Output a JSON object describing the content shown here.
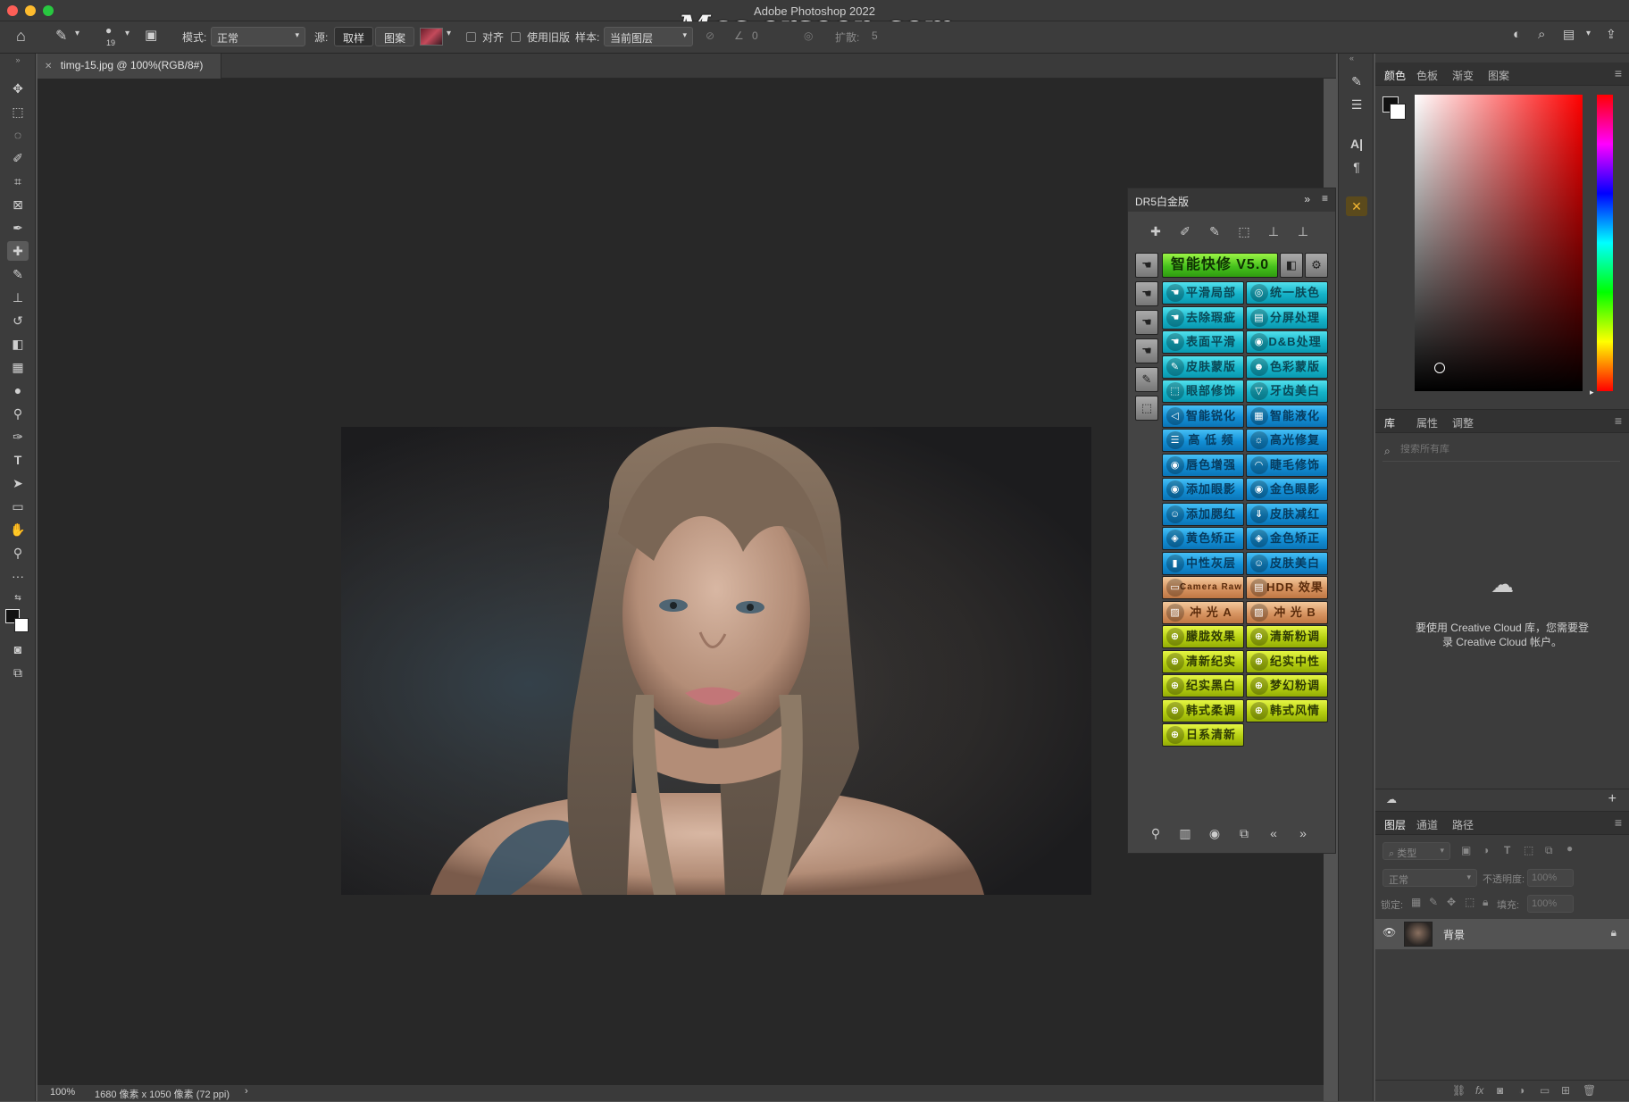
{
  "app": {
    "title": "Adobe Photoshop 2022",
    "watermark": "Mac.orsoon.com"
  },
  "options_bar": {
    "brush_size": "19",
    "mode_label": "模式:",
    "mode_value": "正常",
    "source_label": "源:",
    "sample_btn": "取样",
    "pattern_btn": "图案",
    "align_label": "对齐",
    "legacy_label": "使用旧版",
    "sample_label": "样本:",
    "sample_value": "当前图层",
    "angle_value": "0",
    "diffuse_label": "扩散:",
    "diffuse_value": "5"
  },
  "document": {
    "tab_label": "timg-15.jpg @ 100%(RGB/8#)",
    "zoom": "100%",
    "info": "1680 像素 x 1050 像素 (72 ppi)"
  },
  "drs_panel": {
    "title": "DR5白金版",
    "header_button": "智能快修 V5.0",
    "buttons": [
      {
        "label": "平滑局部",
        "icon": "hand-icon",
        "color": "teal"
      },
      {
        "label": "统一肤色",
        "icon": "swirl-icon",
        "color": "teal"
      },
      {
        "label": "去除瑕疵",
        "icon": "hand-icon",
        "color": "teal"
      },
      {
        "label": "分屏处理",
        "icon": "doc-icon",
        "color": "teal"
      },
      {
        "label": "表面平滑",
        "icon": "hand-icon",
        "color": "teal"
      },
      {
        "label": "D&B处理",
        "icon": "camera-icon",
        "color": "teal"
      },
      {
        "label": "皮肤蒙版",
        "icon": "brush-icon",
        "color": "teal"
      },
      {
        "label": "色彩蒙版",
        "icon": "people-icon",
        "color": "teal"
      },
      {
        "label": "眼部修饰",
        "icon": "select-icon",
        "color": "teal"
      },
      {
        "label": "牙齿美白",
        "icon": "tooth-icon",
        "color": "teal"
      },
      {
        "label": "智能锐化",
        "icon": "triangle-icon",
        "color": "blue"
      },
      {
        "label": "智能液化",
        "icon": "grid-icon",
        "color": "blue"
      },
      {
        "label": "高 低 频",
        "icon": "list-icon",
        "color": "blue"
      },
      {
        "label": "高光修复",
        "icon": "sun-icon",
        "color": "blue"
      },
      {
        "label": "唇色增强",
        "icon": "lips-icon",
        "color": "blue"
      },
      {
        "label": "睫毛修饰",
        "icon": "lash-icon",
        "color": "blue"
      },
      {
        "label": "添加眼影",
        "icon": "eye-icon",
        "color": "blue"
      },
      {
        "label": "金色眼影",
        "icon": "eye-icon",
        "color": "blue"
      },
      {
        "label": "添加腮红",
        "icon": "face-icon",
        "color": "blue"
      },
      {
        "label": "皮肤减红",
        "icon": "download-icon",
        "color": "blue"
      },
      {
        "label": "黄色矫正",
        "icon": "layers-icon",
        "color": "blue"
      },
      {
        "label": "金色矫正",
        "icon": "layers-icon",
        "color": "blue"
      },
      {
        "label": "中性灰层",
        "icon": "bars-icon",
        "color": "blue"
      },
      {
        "label": "皮肤美白",
        "icon": "face-icon",
        "color": "blue"
      },
      {
        "label": "Camera Raw",
        "icon": "monitor-icon",
        "color": "orange"
      },
      {
        "label": "HDR 效果",
        "icon": "printer-icon",
        "color": "orange"
      },
      {
        "label": "冲 光 A",
        "icon": "image-icon",
        "color": "orange"
      },
      {
        "label": "冲 光 B",
        "icon": "image-icon",
        "color": "orange"
      },
      {
        "label": "朦胧效果",
        "icon": "globe-icon",
        "color": "lime"
      },
      {
        "label": "清新粉调",
        "icon": "globe-icon",
        "color": "lime"
      },
      {
        "label": "清新纪实",
        "icon": "globe-icon",
        "color": "lime"
      },
      {
        "label": "纪实中性",
        "icon": "globe-icon",
        "color": "lime"
      },
      {
        "label": "纪实黑白",
        "icon": "globe-icon",
        "color": "lime"
      },
      {
        "label": "梦幻粉调",
        "icon": "globe-icon",
        "color": "lime"
      },
      {
        "label": "韩式柔调",
        "icon": "globe-icon",
        "color": "lime"
      },
      {
        "label": "韩式风情",
        "icon": "globe-icon",
        "color": "lime"
      },
      {
        "label": "日系清新",
        "icon": "globe-icon",
        "color": "lime"
      }
    ]
  },
  "color_panel": {
    "tabs": [
      "颜色",
      "色板",
      "渐变",
      "图案"
    ]
  },
  "library_panel": {
    "tabs": [
      "库",
      "属性",
      "调整"
    ],
    "search_placeholder": "搜索所有库",
    "message_line1": "要使用 Creative Cloud 库，您需要登",
    "message_line2": "录 Creative Cloud 帐户。"
  },
  "layers_panel": {
    "tabs": [
      "图层",
      "通道",
      "路径"
    ],
    "filter_label": "类型",
    "blend_mode": "正常",
    "opacity_label": "不透明度:",
    "opacity_value": "100%",
    "lock_label": "锁定:",
    "fill_label": "填充:",
    "fill_value": "100%",
    "layer_name": "背景"
  }
}
